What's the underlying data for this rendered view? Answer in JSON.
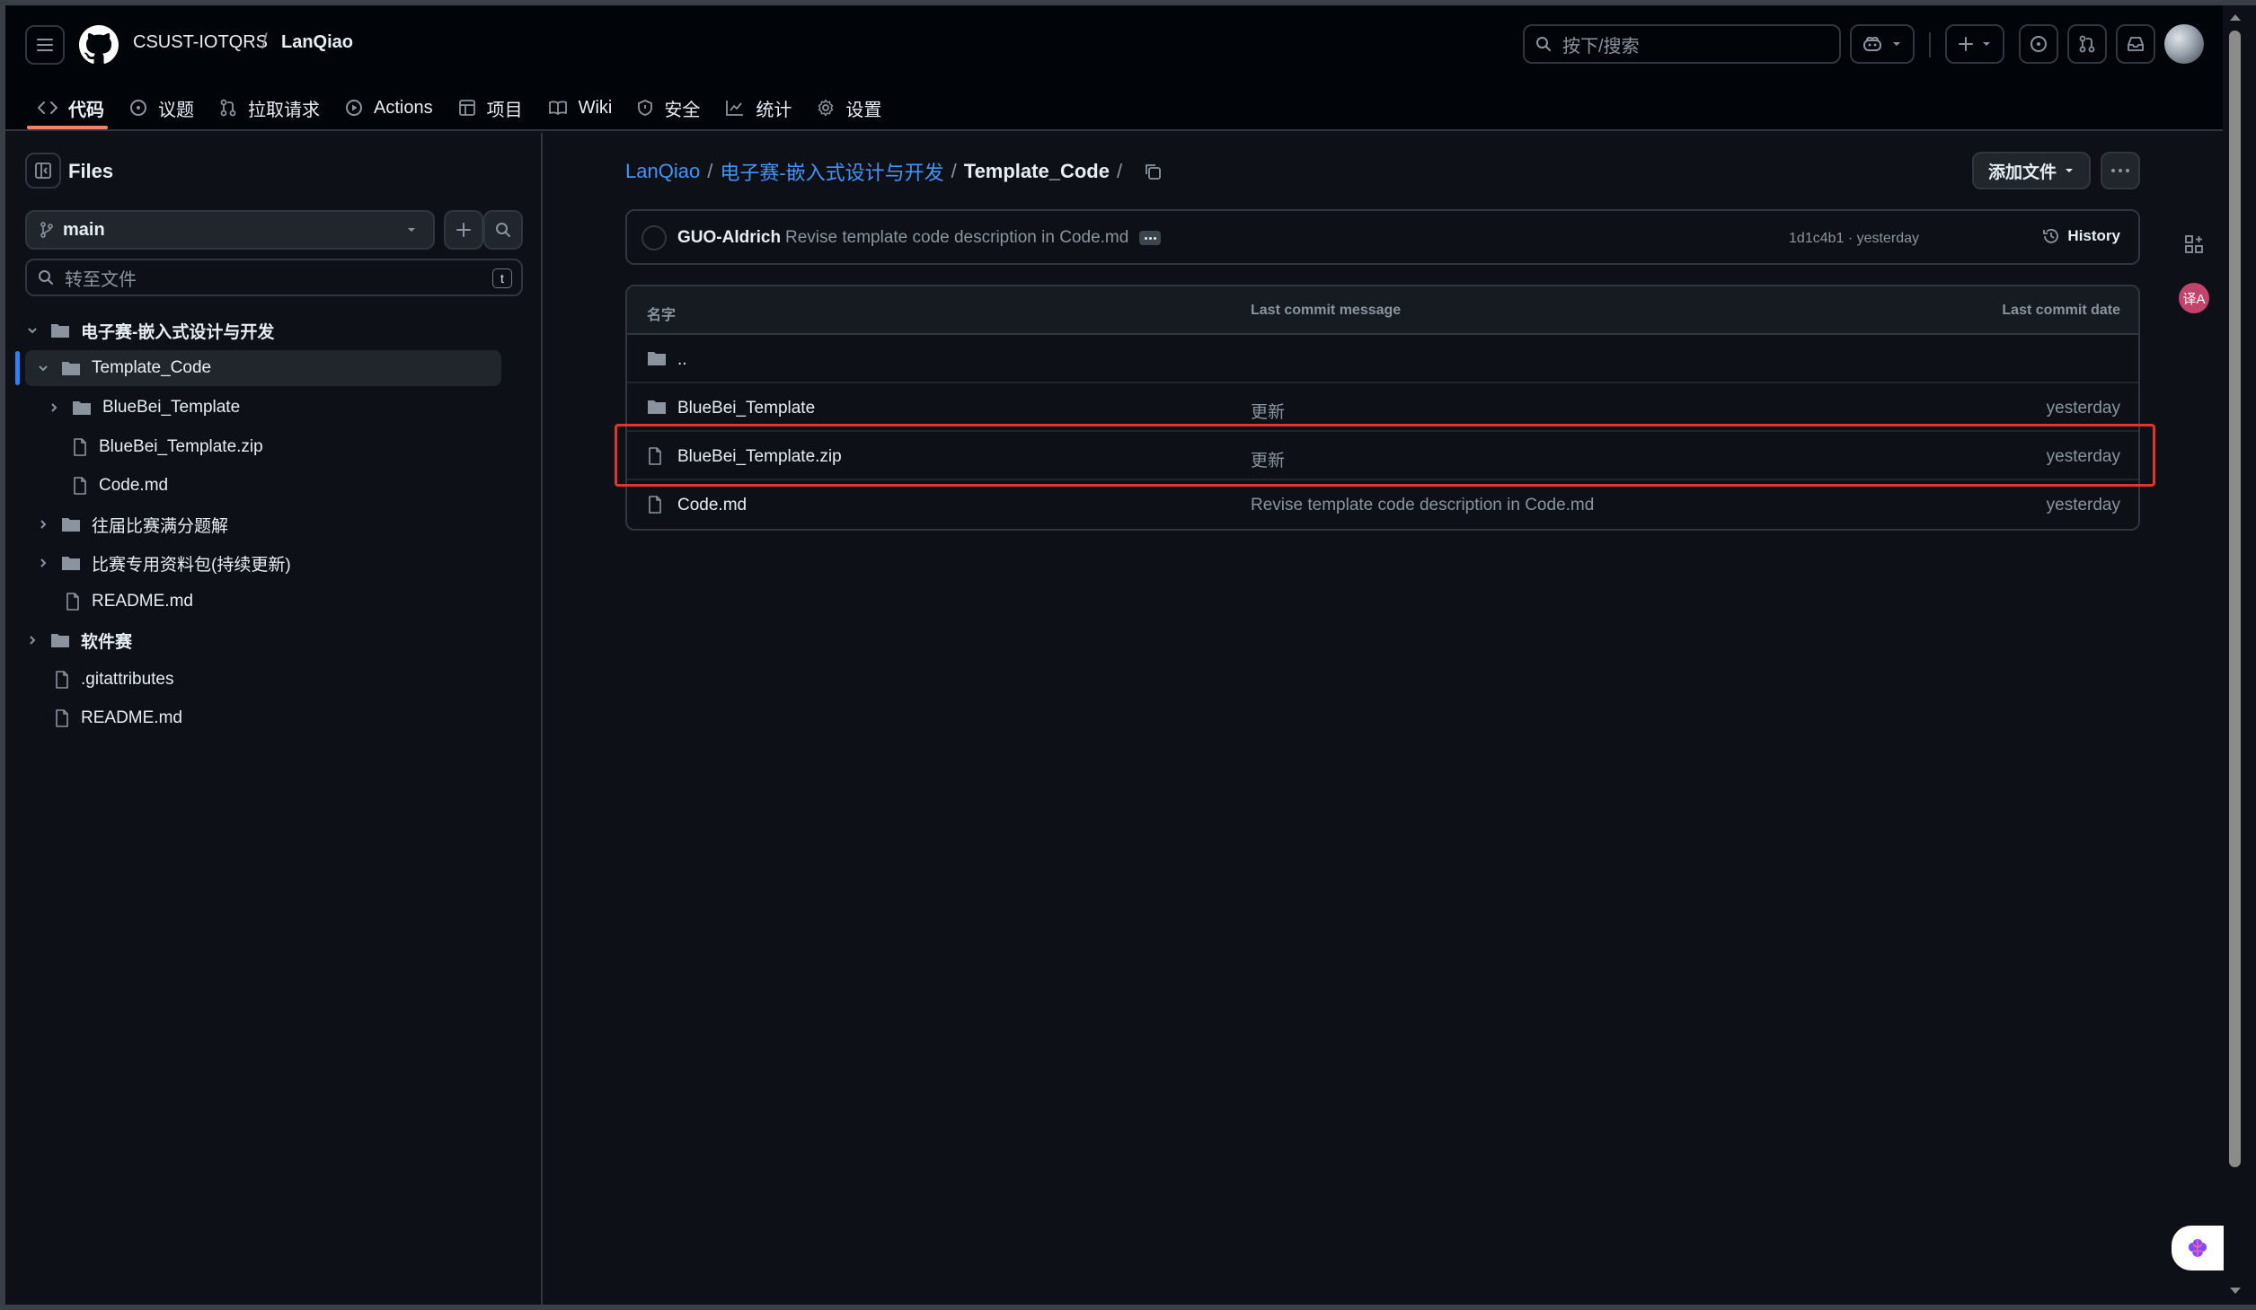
{
  "header": {
    "owner": "CSUST-IOTQRS",
    "separator": "/",
    "repo": "LanQiao",
    "search_placeholder": "按下/搜索"
  },
  "tabs": [
    {
      "label": "代码",
      "icon": "code-icon",
      "active": true
    },
    {
      "label": "议题",
      "icon": "issue-icon"
    },
    {
      "label": "拉取请求",
      "icon": "pull-request-icon"
    },
    {
      "label": "Actions",
      "icon": "play-icon"
    },
    {
      "label": "项目",
      "icon": "table-icon"
    },
    {
      "label": "Wiki",
      "icon": "book-icon"
    },
    {
      "label": "安全",
      "icon": "shield-icon"
    },
    {
      "label": "统计",
      "icon": "graph-icon"
    },
    {
      "label": "设置",
      "icon": "gear-icon"
    }
  ],
  "sidebar": {
    "title": "Files",
    "branch": "main",
    "goto_placeholder": "转至文件",
    "goto_shortcut": "t",
    "tree": [
      {
        "label": "电子赛-嵌入式设计与开发",
        "type": "folder",
        "expanded": true,
        "bold": true
      },
      {
        "label": "Template_Code",
        "type": "folder",
        "expanded": true,
        "active": true
      },
      {
        "label": "BlueBei_Template",
        "type": "folder",
        "expanded": false
      },
      {
        "label": "BlueBei_Template.zip",
        "type": "file"
      },
      {
        "label": "Code.md",
        "type": "file"
      },
      {
        "label": "往届比赛满分题解",
        "type": "folder",
        "expanded": false
      },
      {
        "label": "比赛专用资料包(持续更新)",
        "type": "folder",
        "expanded": false
      },
      {
        "label": "README.md",
        "type": "file"
      },
      {
        "label": "软件赛",
        "type": "folder",
        "expanded": false
      },
      {
        "label": ".gitattributes",
        "type": "file"
      },
      {
        "label": "README.md",
        "type": "file"
      }
    ]
  },
  "breadcrumb": {
    "root": "LanQiao",
    "sep": "/",
    "folder": "电子赛-嵌入式设计与开发",
    "current": "Template_Code",
    "trailing": "/"
  },
  "actions": {
    "add_file": "添加文件"
  },
  "commit": {
    "author": "GUO-Aldrich",
    "message": "Revise template code description in Code.md",
    "meta": "1d1c4b1 · yesterday",
    "history": "History"
  },
  "table": {
    "headers": {
      "name": "名字",
      "message": "Last commit message",
      "date": "Last commit date"
    },
    "parent": "..",
    "rows": [
      {
        "name": "BlueBei_Template",
        "type": "folder",
        "message": "更新",
        "date": "yesterday"
      },
      {
        "name": "BlueBei_Template.zip",
        "type": "file",
        "message": "更新",
        "date": "yesterday"
      },
      {
        "name": "Code.md",
        "type": "file",
        "message": "Revise template code description in Code.md",
        "date": "yesterday"
      }
    ]
  },
  "right_rail": {
    "translate_badge": "译A"
  },
  "colors": {
    "background": "#0d1117",
    "header": "#010409",
    "border": "#30363d",
    "link": "#4493f8",
    "active_tab": "#f78166",
    "highlight": "#e5322d",
    "muted": "#8b949e"
  }
}
